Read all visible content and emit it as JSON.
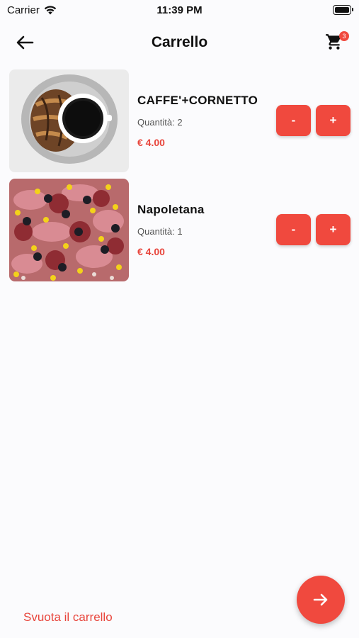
{
  "status_bar": {
    "carrier": "Carrier",
    "time": "11:39 PM"
  },
  "header": {
    "title": "Carrello",
    "cart_count": "3"
  },
  "items": [
    {
      "name": "CAFFE'+CORNETTO",
      "quantity": "Quantità: 2",
      "price": "€ 4.00",
      "minus_label": "-",
      "plus_label": "+"
    },
    {
      "name": "Napoletana",
      "quantity": "Quantità: 1",
      "price": "€ 4.00",
      "minus_label": "-",
      "plus_label": "+"
    }
  ],
  "footer": {
    "empty_cart_label": "Svuota il carrello"
  },
  "colors": {
    "accent": "#f0493e",
    "background": "#fbfbfd"
  }
}
